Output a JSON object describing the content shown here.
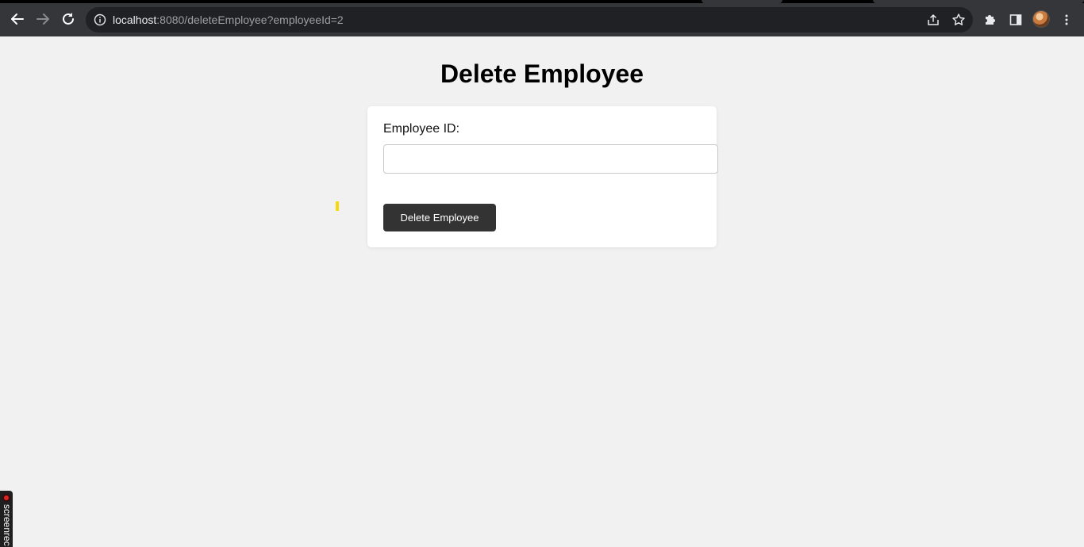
{
  "browser": {
    "url_host": "localhost",
    "url_rest": ":8080/deleteEmployee?employeeId=2",
    "icons": {
      "back": "arrow-left-icon",
      "forward": "arrow-right-icon",
      "reload": "reload-icon",
      "site_info": "info-icon",
      "share": "share-icon",
      "bookmark": "star-icon",
      "extensions": "puzzle-icon",
      "side_panel": "side-panel-icon",
      "profile": "avatar",
      "menu": "kebab-menu-icon"
    },
    "colors": {
      "toolbar": "#35363a",
      "omnibox": "#202124"
    }
  },
  "page": {
    "title": "Delete Employee",
    "form": {
      "employee_id_label": "Employee ID:",
      "employee_id_value": "",
      "submit_label": "Delete Employee"
    },
    "colors": {
      "background": "#f1f1f1",
      "card": "#ffffff",
      "button": "#333333"
    }
  },
  "recorder": {
    "label": "screenrec"
  }
}
